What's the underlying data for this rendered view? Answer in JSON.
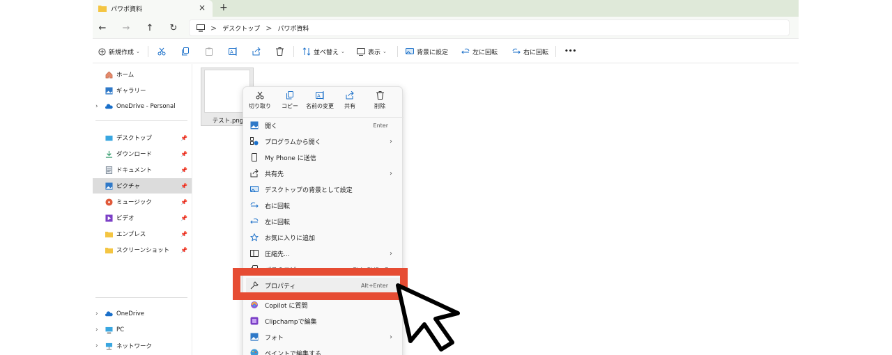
{
  "tab": {
    "title": "パワポ資料",
    "close": "×",
    "new_tab": "+"
  },
  "nav": {
    "back": "←",
    "forward": "→",
    "up": "↑",
    "refresh": "↻"
  },
  "address": {
    "crumbs": [
      "デスクトップ",
      "パワポ資料"
    ],
    "sep": ">"
  },
  "commands": {
    "new": "新規作成",
    "sort": "並べ替え",
    "view": "表示",
    "set_background": "背景に設定",
    "rotate_left": "左に回転",
    "rotate_right": "右に回転",
    "more": "•••"
  },
  "sidebar": {
    "items": [
      {
        "label": "ホーム"
      },
      {
        "label": "ギャラリー"
      },
      {
        "label": "OneDrive - Personal"
      },
      {
        "label": "デスクトップ"
      },
      {
        "label": "ダウンロード"
      },
      {
        "label": "ドキュメント"
      },
      {
        "label": "ピクチャ"
      },
      {
        "label": "ミュージック"
      },
      {
        "label": "ビデオ"
      },
      {
        "label": "エンプレス"
      },
      {
        "label": "スクリーンショット"
      },
      {
        "label": "OneDrive"
      },
      {
        "label": "PC"
      },
      {
        "label": "ネットワーク"
      }
    ]
  },
  "file": {
    "name": "テスト.png"
  },
  "context_menu": {
    "quick": [
      "切り取り",
      "コピー",
      "名前の変更",
      "共有",
      "削除"
    ],
    "items": [
      {
        "label": "開く",
        "shortcut": "Enter"
      },
      {
        "label": "プログラムから開く",
        "submenu": "›"
      },
      {
        "label": "My Phone に送信"
      },
      {
        "label": "共有先",
        "submenu": "›"
      },
      {
        "label": "デスクトップの背景として設定"
      },
      {
        "label": "右に回転"
      },
      {
        "label": "左に回転"
      },
      {
        "label": "お気に入りに追加"
      },
      {
        "label": "圧縮先...",
        "submenu": "›"
      },
      {
        "label": "パスのコピー",
        "shortcut": "Ctrl+Shift+C"
      },
      {
        "label": "プロパティ",
        "shortcut": "Alt+Enter"
      },
      {
        "label": "Copilot に質問"
      },
      {
        "label": "Clipchampで編集"
      },
      {
        "label": "フォト",
        "submenu": "›"
      },
      {
        "label": "ペイントで編集する"
      }
    ]
  },
  "colors": {
    "highlight": "#e64c33",
    "accent": "#1a6fc9",
    "folder": "#f4c542"
  }
}
